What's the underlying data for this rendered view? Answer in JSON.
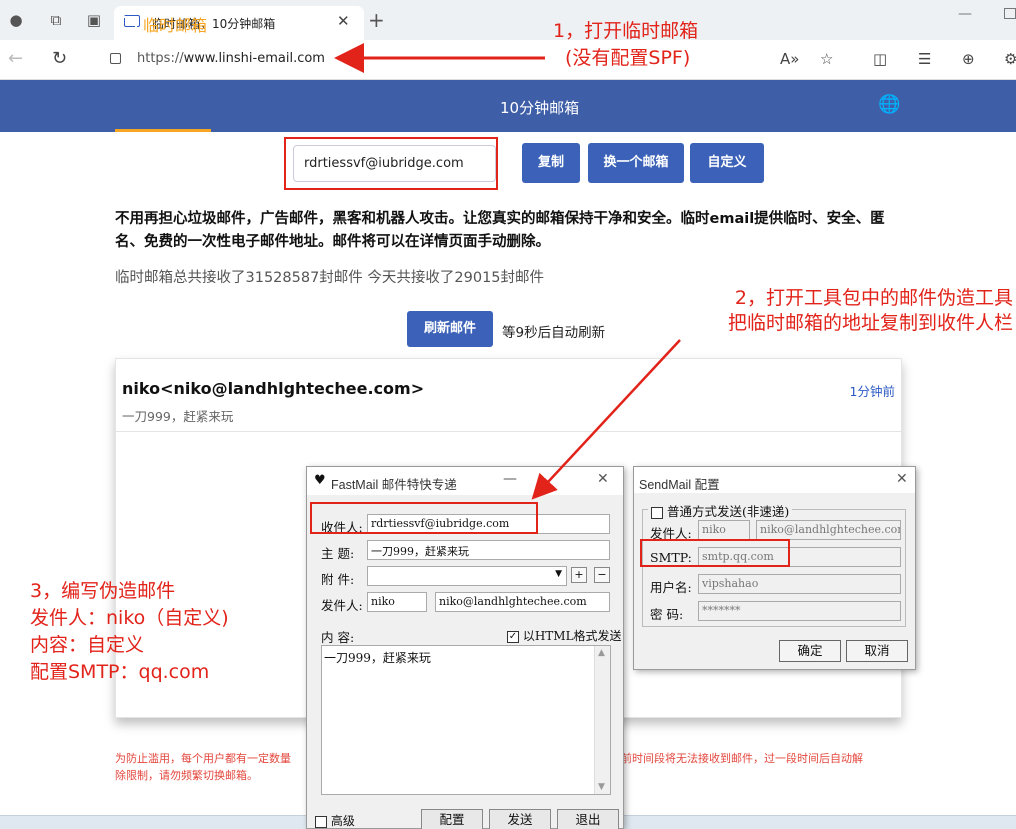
{
  "browser": {
    "tab_title": "临时邮箱，10分钟邮箱",
    "url_proto": "https://",
    "url_host": "www.linshi-email.com"
  },
  "site": {
    "logo_text": "临时邮箱",
    "nav_center": "10分钟邮箱",
    "email_value": "rdrtiessvf@iubridge.com",
    "copy_label": "复制",
    "change_label": "换一个邮箱",
    "custom_label": "自定义",
    "intro_text": "不用再担心垃圾邮件，广告邮件，黑客和机器人攻击。让您真实的邮箱保持干净和安全。临时email提供临时、安全、匿名、免费的一次性电子邮件地址。邮件将可以在详情页面手动删除。",
    "stats_text": "临时邮箱总共接收了31528587封邮件 今天共接收了29015封邮件",
    "refresh_label": "刷新邮件",
    "refresh_note": "等9秒后自动刷新",
    "mail": {
      "from": "niko<niko@landhlghtechee.com>",
      "subject": "一刀999，赶紧来玩",
      "time": "1分钟前"
    },
    "footer_line1": "为防止滥用，每个用户都有一定数量",
    "footer_line1b": "前时间段将无法接收到邮件，过一段时间后自动解",
    "footer_line2": "除限制，请勿频繁切换邮箱。"
  },
  "annotations": {
    "a1_line1": "1，打开临时邮箱",
    "a1_line2": "(没有配置SPF)",
    "a2_line1": "2，打开工具包中的邮件伪造工具",
    "a2_line2": "把临时邮箱的地址复制到收件人栏",
    "a3_line1": "3，编写伪造邮件",
    "a3_line2": "发件人：niko（自定义)",
    "a3_line3": "内容：自定义",
    "a3_line4": "配置SMTP：qq.com"
  },
  "fastmail": {
    "title": "FastMail 邮件特快专递",
    "to_label": "收件人:",
    "to_value": "rdrtiessvf@iubridge.com",
    "subject_label": "主  题:",
    "subject_value": "一刀999，赶紧来玩",
    "attach_label": "附  件:",
    "from_label": "发件人:",
    "from_name": "niko",
    "from_addr": "niko@landhlghtechee.com",
    "content_label": "内  容:",
    "html_label": "以HTML格式发送",
    "body": "一刀999，赶紧来玩",
    "advanced_label": "高级",
    "config_label": "配置",
    "send_label": "发送",
    "exit_label": "退出"
  },
  "sendmail": {
    "title": "SendMail 配置",
    "normal_label": "普通方式发送(非速递)",
    "sender_label": "发件人:",
    "sender_name": "niko",
    "sender_addr": "niko@landhlghtechee.com",
    "smtp_label": "SMTP:",
    "smtp_value": "smtp.qq.com",
    "user_label": "用户名:",
    "user_value": "vipshahao",
    "pwd_label": "密  码:",
    "pwd_value": "*******",
    "ok_label": "确定",
    "cancel_label": "取消"
  }
}
